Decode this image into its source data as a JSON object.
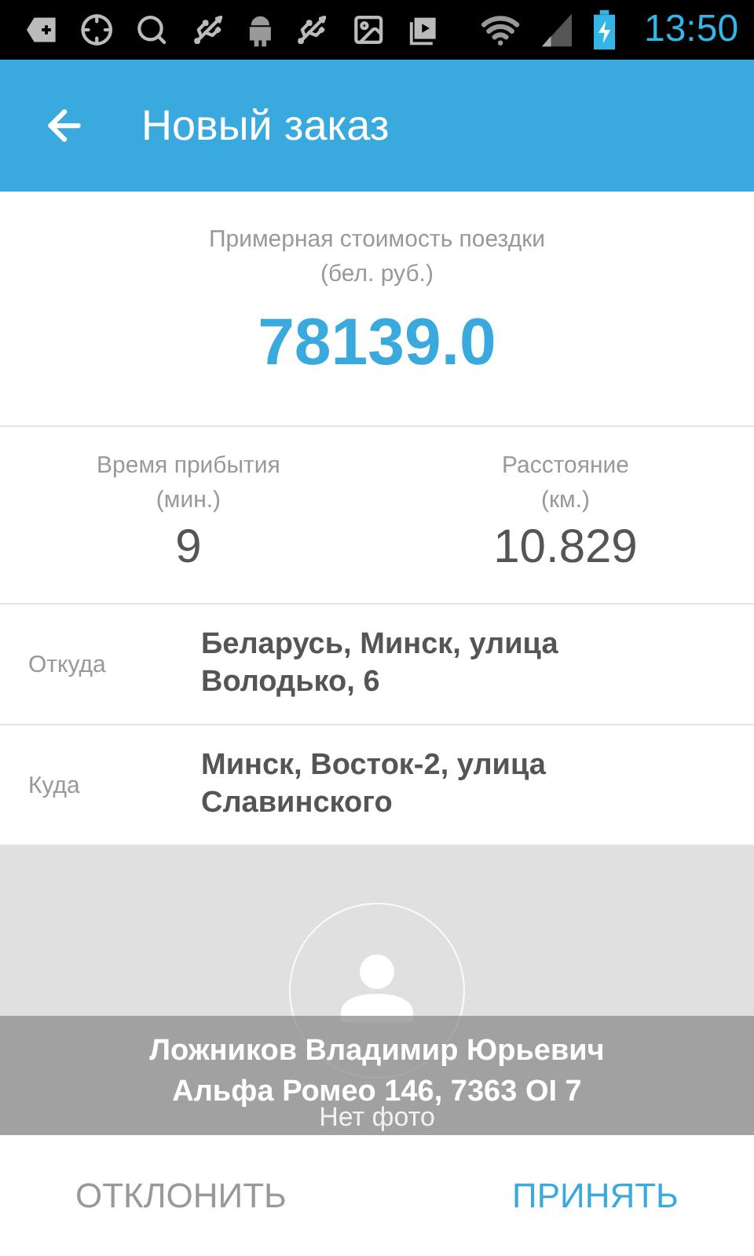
{
  "status_bar": {
    "time": "13:50"
  },
  "app_bar": {
    "title": "Новый заказ"
  },
  "cost": {
    "label": "Примерная стоимость поездки",
    "unit": "(бел. руб.)",
    "value": "78139.0"
  },
  "stats": [
    {
      "label": "Время прибытия",
      "unit": "(мин.)",
      "value": "9"
    },
    {
      "label": "Расстояние",
      "unit": "(км.)",
      "value": "10.829"
    }
  ],
  "route": [
    {
      "label": "Откуда",
      "address": "Беларусь, Минск, улица Володько, 6"
    },
    {
      "label": "Куда",
      "address": "Минск, Восток-2, улица Славинского"
    }
  ],
  "driver": {
    "photo_placeholder": "Нет фото",
    "name": "Ложников Владимир Юрьевич",
    "car": "Альфа Ромео 146, 7363 OI 7"
  },
  "actions": [
    {
      "label": "ОТКЛОНИТЬ",
      "kind": "secondary"
    },
    {
      "label": "ПРИНЯТЬ",
      "kind": "primary"
    }
  ]
}
